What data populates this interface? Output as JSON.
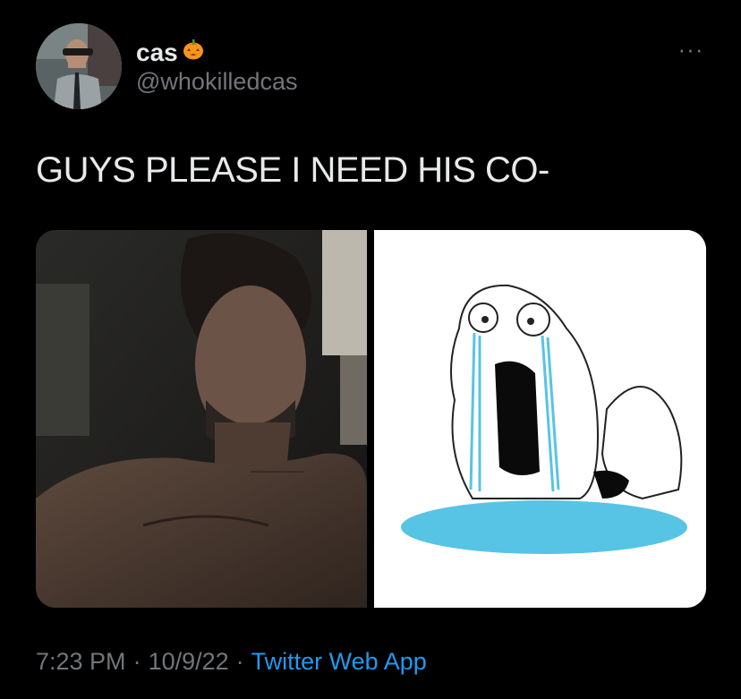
{
  "tweet": {
    "display_name": "cas",
    "name_emoji": "pumpkin-icon",
    "handle": "@whokilledcas",
    "text": "GUYS PLEASE I NEED HIS CO-",
    "time": "7:23 PM",
    "separator": "·",
    "date": "10/9/22",
    "source": "Twitter Web App",
    "more_glyph": "···"
  },
  "colors": {
    "background": "#000000",
    "primary_text": "#e7e9ea",
    "secondary_text": "#71767b",
    "link": "#1d9bf0",
    "tear_blue": "#57c4e5",
    "puddle_blue": "#57c4e5",
    "pumpkin_orange": "#f7941d"
  }
}
